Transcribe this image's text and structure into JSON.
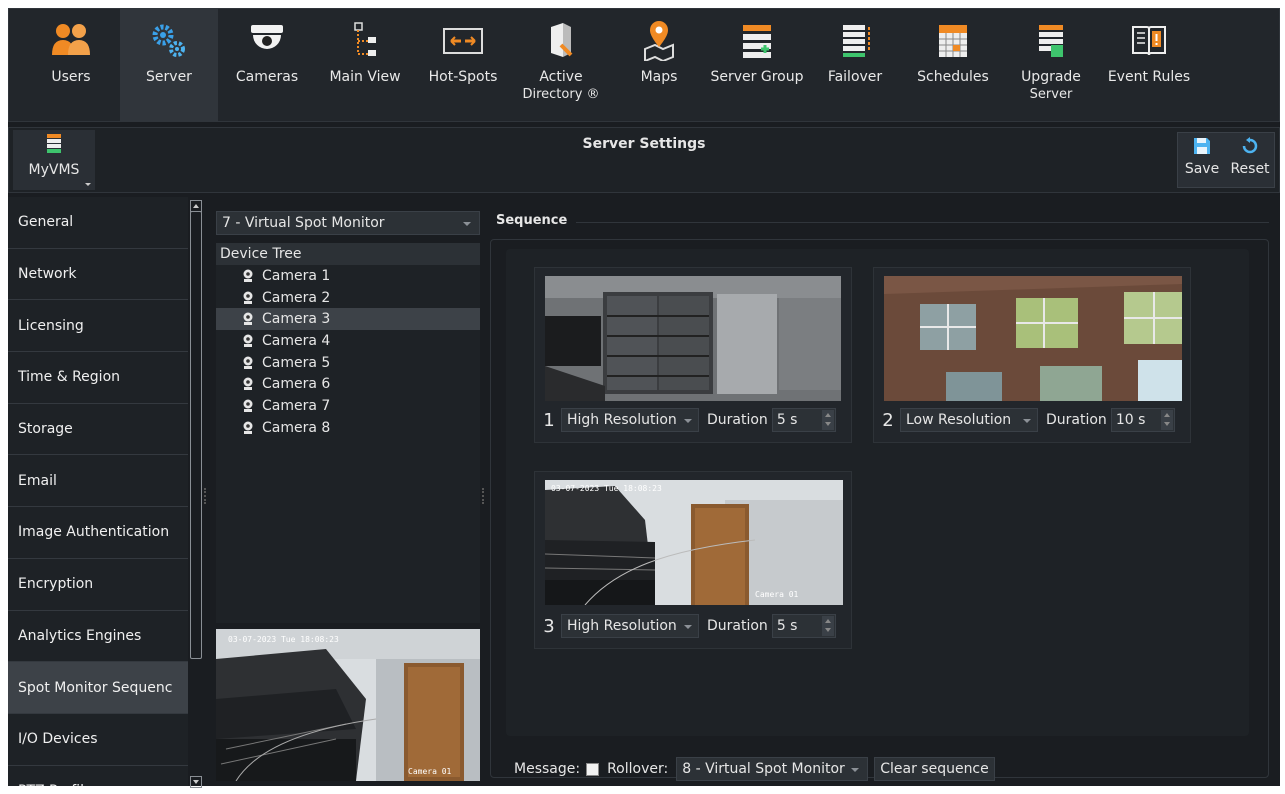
{
  "toolbar": {
    "items": [
      {
        "label": "Users",
        "icon": "users-icon"
      },
      {
        "label": "Server",
        "icon": "server-gears-icon",
        "active": true
      },
      {
        "label": "Cameras",
        "icon": "dome-camera-icon"
      },
      {
        "label": "Main View",
        "icon": "tree-view-icon"
      },
      {
        "label": "Hot-Spots",
        "icon": "hot-spot-icon"
      },
      {
        "label": "Active",
        "sub": "Directory ®",
        "icon": "active-directory-icon"
      },
      {
        "label": "Maps",
        "icon": "map-pin-icon"
      },
      {
        "label": "Server Group",
        "icon": "server-group-icon"
      },
      {
        "label": "Failover",
        "icon": "failover-icon"
      },
      {
        "label": "Schedules",
        "icon": "calendar-icon"
      },
      {
        "label": "Upgrade",
        "sub": "Server",
        "icon": "upgrade-server-icon"
      },
      {
        "label": "Event Rules",
        "icon": "event-rules-book-icon"
      }
    ]
  },
  "header": {
    "server_name": "MyVMS",
    "title": "Server Settings",
    "save_label": "Save",
    "reset_label": "Reset"
  },
  "nav": {
    "items": [
      "General",
      "Network",
      "Licensing",
      "Time & Region",
      "Storage",
      "Email",
      "Image Authentication",
      "Encryption",
      "Analytics Engines",
      "Spot Monitor Sequenc",
      "I/O Devices",
      "PTZ Profiles"
    ],
    "active_index": 9
  },
  "monitor_select": "7 - Virtual Spot Monitor",
  "device_tree": {
    "header": "Device Tree",
    "cameras": [
      "Camera 1",
      "Camera 2",
      "Camera 3",
      "Camera 4",
      "Camera 5",
      "Camera 6",
      "Camera 7",
      "Camera 8"
    ],
    "selected_index": 2
  },
  "preview": {
    "timestamp": "03-07-2023 Tue 18:08:23",
    "caption": "Camera 01"
  },
  "sequence": {
    "title": "Sequence",
    "duration_label": "Duration",
    "items": [
      {
        "index": "1",
        "resolution": "High Resolution",
        "duration": "5 s"
      },
      {
        "index": "2",
        "resolution": "Low Resolution",
        "duration": "10 s"
      },
      {
        "index": "3",
        "resolution": "High Resolution",
        "duration": "5 s"
      }
    ],
    "item3_timestamp": "03-07-2023 Tue 18:08:23",
    "item3_caption": "Camera 01"
  },
  "footer": {
    "message_label": "Message:",
    "message_checked": false,
    "rollover_label": "Rollover:",
    "rollover_value": "8 - Virtual Spot Monitor",
    "clear_label": "Clear sequence"
  },
  "colors": {
    "background": "#1a1d21",
    "panel": "#22262b",
    "selected": "#3d4248",
    "accent_orange": "#f08a24",
    "accent_blue": "#3aa0e8"
  }
}
